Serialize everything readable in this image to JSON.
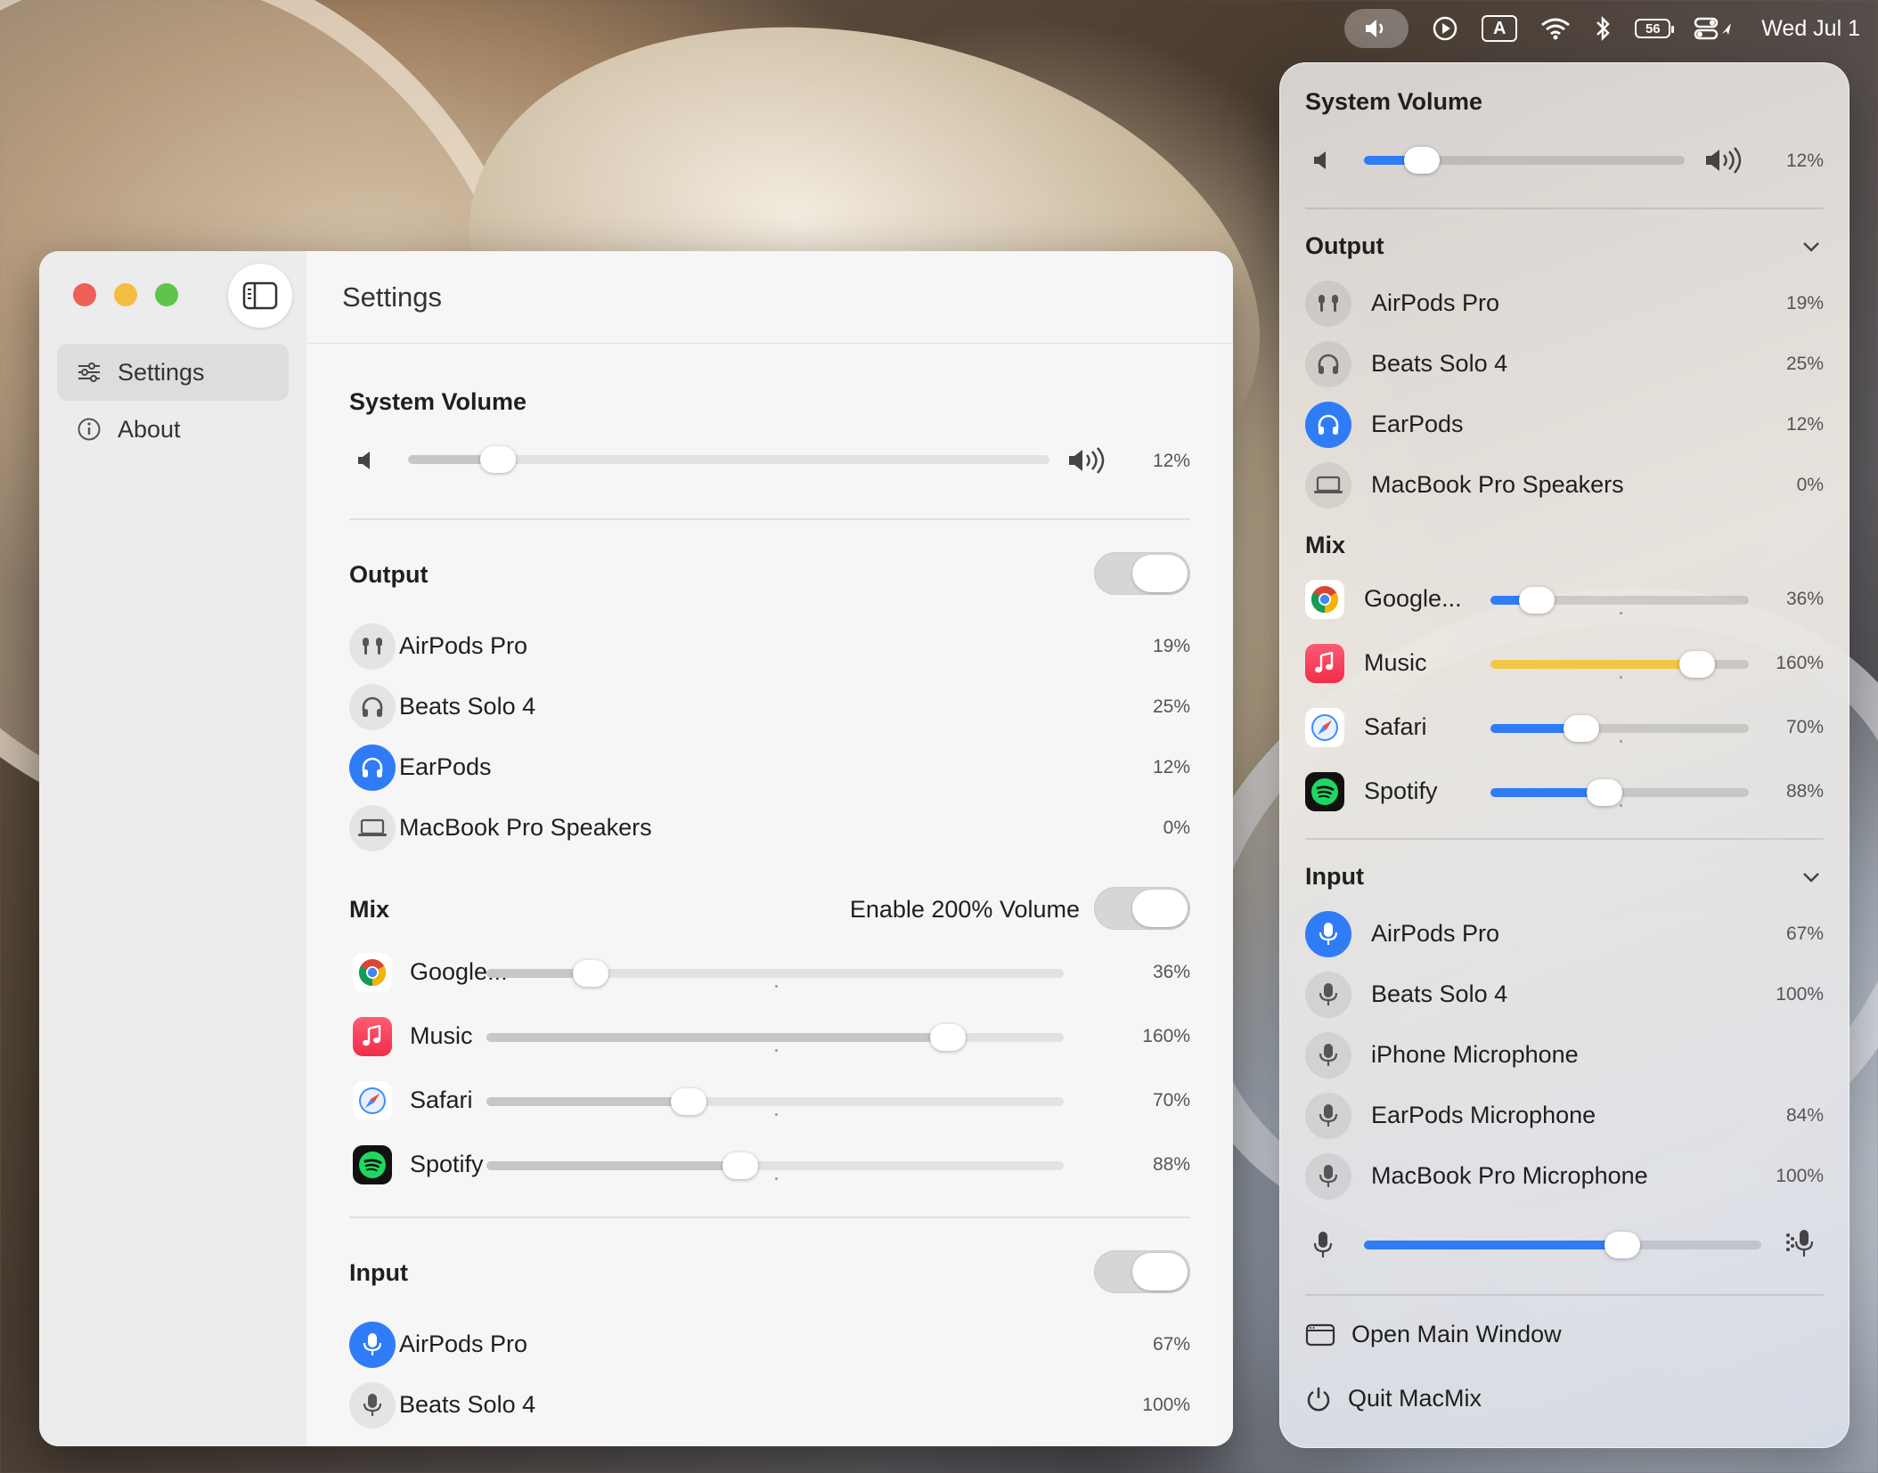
{
  "menubar": {
    "time": "Wed Jul 1",
    "battery": "56",
    "input_badge": "A",
    "icons": [
      "speaker-icon",
      "play-circle-icon",
      "input-source-icon",
      "wifi-icon",
      "bluetooth-icon",
      "battery-icon",
      "control-center-icon"
    ]
  },
  "window": {
    "sidebar": {
      "items": [
        {
          "label": "Settings",
          "icon": "sliders-icon",
          "selected": true
        },
        {
          "label": "About",
          "icon": "info-icon",
          "selected": false
        }
      ]
    },
    "header_title": "Settings",
    "system_volume": {
      "title": "System Volume",
      "value": 12,
      "pct": "12%"
    },
    "output": {
      "title": "Output",
      "toggle_on": false,
      "devices": [
        {
          "name": "AirPods Pro",
          "pct": "19%",
          "icon": "airpods-icon",
          "active": false
        },
        {
          "name": "Beats Solo 4",
          "pct": "25%",
          "icon": "headphones-icon",
          "active": false
        },
        {
          "name": "EarPods",
          "pct": "12%",
          "icon": "headphones-icon",
          "active": true
        },
        {
          "name": "MacBook Pro Speakers",
          "pct": "0%",
          "icon": "laptop-icon",
          "active": false
        }
      ]
    },
    "mix": {
      "title": "Mix",
      "enable_label": "Enable 200% Volume",
      "apps": [
        {
          "name": "Google...",
          "pct": "36%",
          "value": 36,
          "icon": "chrome-icon"
        },
        {
          "name": "Music",
          "pct": "160%",
          "value": 160,
          "icon": "music-icon"
        },
        {
          "name": "Safari",
          "pct": "70%",
          "value": 70,
          "icon": "safari-icon"
        },
        {
          "name": "Spotify",
          "pct": "88%",
          "value": 88,
          "icon": "spotify-icon"
        }
      ]
    },
    "input": {
      "title": "Input",
      "toggle_on": false,
      "devices": [
        {
          "name": "AirPods Pro",
          "pct": "67%",
          "active": true
        },
        {
          "name": "Beats Solo 4",
          "pct": "100%",
          "active": false
        }
      ]
    }
  },
  "popover": {
    "system_volume": {
      "title": "System Volume",
      "value": 12,
      "pct": "12%"
    },
    "output": {
      "title": "Output",
      "devices": [
        {
          "name": "AirPods Pro",
          "pct": "19%",
          "icon": "airpods-icon",
          "active": false
        },
        {
          "name": "Beats Solo 4",
          "pct": "25%",
          "icon": "headphones-icon",
          "active": false
        },
        {
          "name": "EarPods",
          "pct": "12%",
          "icon": "headphones-icon",
          "active": true
        },
        {
          "name": "MacBook Pro Speakers",
          "pct": "0%",
          "icon": "laptop-icon",
          "active": false
        }
      ]
    },
    "mix": {
      "title": "Mix",
      "apps": [
        {
          "name": "Google...",
          "pct": "36%",
          "value": 36,
          "color": "#2f7cf6"
        },
        {
          "name": "Music",
          "pct": "160%",
          "value": 160,
          "color": "#f2c744"
        },
        {
          "name": "Safari",
          "pct": "70%",
          "value": 70,
          "color": "#2f7cf6"
        },
        {
          "name": "Spotify",
          "pct": "88%",
          "value": 88,
          "color": "#2f7cf6"
        }
      ]
    },
    "input": {
      "title": "Input",
      "devices": [
        {
          "name": "AirPods Pro",
          "pct": "67%",
          "active": true
        },
        {
          "name": "Beats Solo 4",
          "pct": "100%",
          "active": false
        },
        {
          "name": "iPhone Microphone",
          "pct": "",
          "active": false
        },
        {
          "name": "EarPods Microphone",
          "pct": "84%",
          "active": false
        },
        {
          "name": "MacBook Pro Microphone",
          "pct": "100%",
          "active": false
        }
      ],
      "level": 67
    },
    "actions": {
      "open": "Open Main Window",
      "quit": "Quit MacMix"
    }
  },
  "colors": {
    "accent": "#2f7cf6",
    "boost": "#f2c744"
  }
}
